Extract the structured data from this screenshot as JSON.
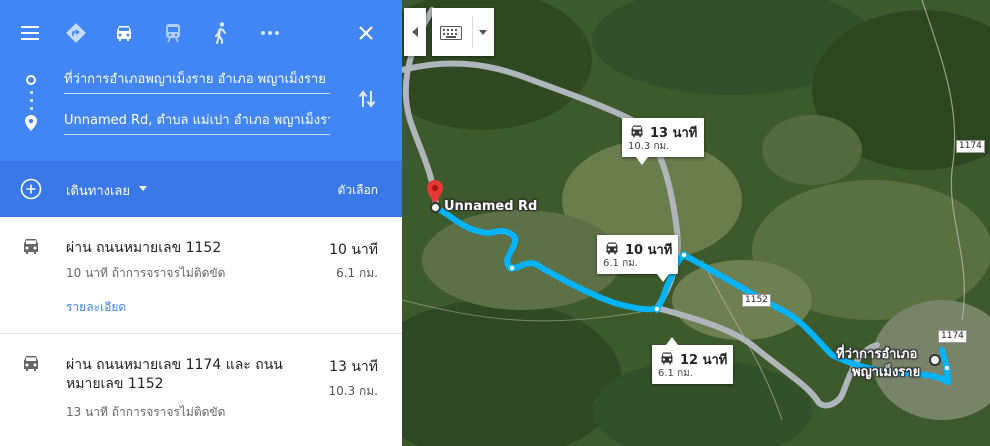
{
  "header": {
    "menu_icon": "menu-icon",
    "modes": [
      {
        "name": "best-route-icon",
        "active": false
      },
      {
        "name": "car-icon",
        "active": true
      },
      {
        "name": "transit-icon",
        "active": false
      },
      {
        "name": "walking-icon",
        "active": false
      },
      {
        "name": "more-icon",
        "active": false
      }
    ],
    "close_icon": "close-icon"
  },
  "route_inputs": {
    "origin": "ที่ว่าการอำเภอพญาเม็งราย อำเภอ พญาเม็งราย",
    "destination": "Unnamed Rd, ตำบล แม่เปา อำเภอ พญาเม็งราย"
  },
  "subbar": {
    "depart_label": "เดินทางเลย",
    "options_label": "ตัวเลือก"
  },
  "routes": [
    {
      "title": "ผ่าน ถนนหมายเลข 1152",
      "duration": "10 นาที",
      "distance": "6.1 กม.",
      "traffic_note": "10 นาที ถ้าการจราจรไม่ติดขัด",
      "details_label": "รายละเอียด"
    },
    {
      "title": "ผ่าน ถนนหมายเลข 1174 และ ถนนหมายเลข 1152",
      "duration": "13 นาที",
      "distance": "10.3 กม.",
      "traffic_note": "13 นาที ถ้าการจราจรไม่ติดขัด"
    }
  ],
  "map": {
    "callouts": [
      {
        "duration": "13 นาที",
        "distance": "10.3 กม."
      },
      {
        "duration": "10 นาที",
        "distance": "6.1 กม."
      },
      {
        "duration": "12 นาที",
        "distance": "6.1 กม."
      }
    ],
    "destination_label": "Unnamed Rd",
    "origin_label_line1": "ที่ว่าการอำเภอ",
    "origin_label_line2": "พญาเม็งราย",
    "road_shields": [
      "1174",
      "1152",
      "1174"
    ],
    "colors": {
      "route": "#00b3fd",
      "alt_route": "#b0b4bb",
      "header": "#4285f4"
    }
  }
}
